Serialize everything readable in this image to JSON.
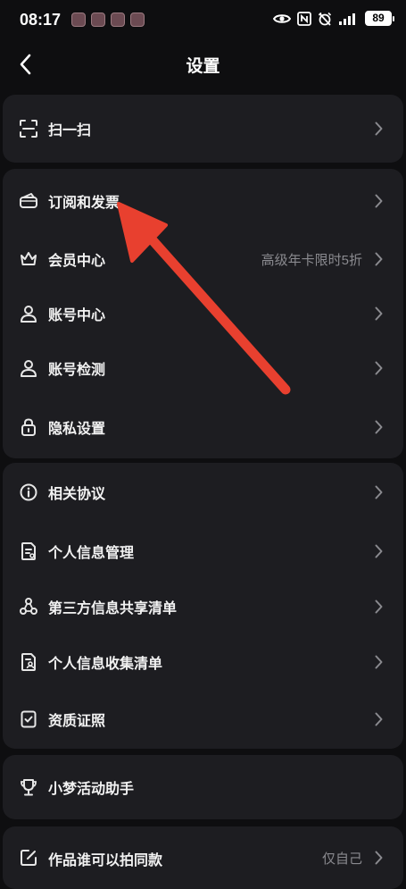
{
  "status_bar": {
    "time": "08:17",
    "battery": "89"
  },
  "nav": {
    "title": "设置"
  },
  "groups": [
    {
      "items": [
        {
          "label": "扫一扫",
          "icon": "scan-icon"
        }
      ]
    },
    {
      "items": [
        {
          "label": "订阅和发票",
          "icon": "wallet-icon"
        },
        {
          "label": "会员中心",
          "icon": "crown-icon",
          "value": "高级年卡限时5折"
        },
        {
          "label": "账号中心",
          "icon": "user-icon"
        },
        {
          "label": "账号检测",
          "icon": "user-icon"
        },
        {
          "label": "隐私设置",
          "icon": "lock-icon"
        }
      ]
    },
    {
      "items": [
        {
          "label": "相关协议",
          "icon": "info-icon"
        },
        {
          "label": "个人信息管理",
          "icon": "document-icon"
        },
        {
          "label": "第三方信息共享清单",
          "icon": "share-nodes-icon"
        },
        {
          "label": "个人信息收集清单",
          "icon": "document-user-icon"
        },
        {
          "label": "资质证照",
          "icon": "certificate-icon"
        }
      ]
    },
    {
      "items": [
        {
          "label": "小梦活动助手",
          "icon": "trophy-icon"
        }
      ]
    },
    {
      "items": [
        {
          "label": "作品谁可以拍同款",
          "icon": "edit-icon",
          "value": "仅自己"
        }
      ]
    }
  ],
  "annotation": {
    "color": "#e8402f"
  }
}
